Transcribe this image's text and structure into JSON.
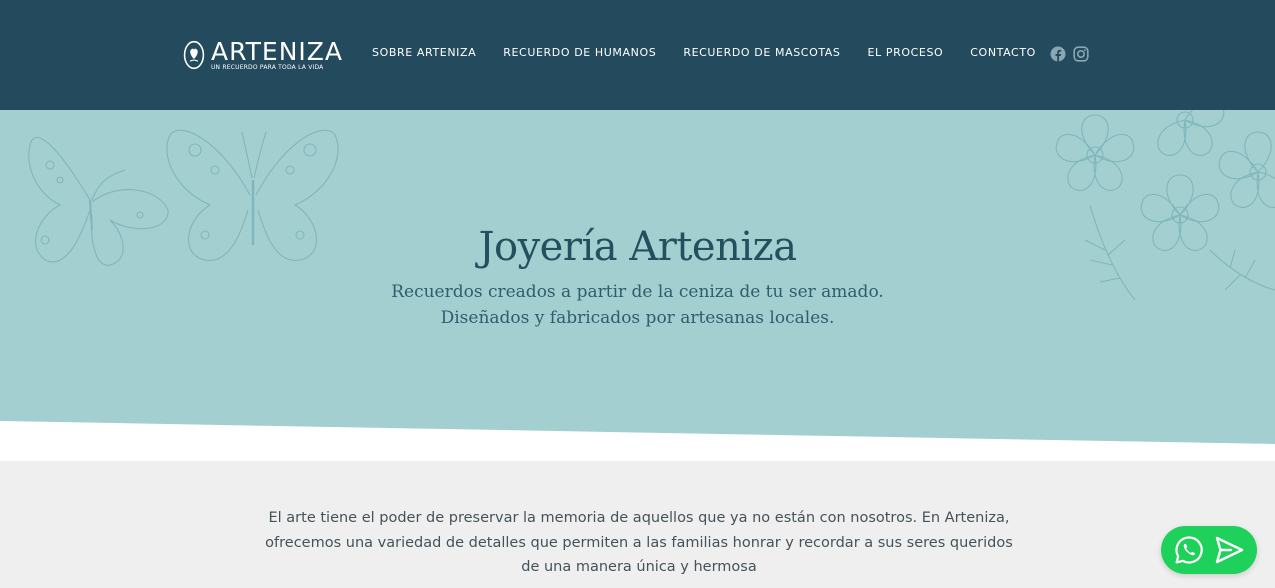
{
  "header": {
    "logo": {
      "name": "ARTENIZA",
      "tagline": "UN RECUERDO PARA TODA LA VIDA",
      "icon": "arteniza-logo-icon"
    },
    "nav": [
      {
        "label": "SOBRE ARTENIZA"
      },
      {
        "label": "RECUERDO DE HUMANOS"
      },
      {
        "label": "RECUERDO DE MASCOTAS"
      },
      {
        "label": "EL PROCESO"
      },
      {
        "label": "CONTACTO"
      }
    ],
    "social": [
      {
        "icon": "facebook-icon"
      },
      {
        "icon": "instagram-icon"
      }
    ]
  },
  "hero": {
    "title": "Joyería Arteniza",
    "subtitle_line1": "Recuerdos creados a partir de la ceniza de tu ser amado.",
    "subtitle_line2": "Diseñados y fabricados por artesanas locales."
  },
  "intro": {
    "text": "El arte tiene el poder de preservar la memoria de aquellos que ya no están con nosotros. En Arteniza, ofrecemos una variedad de detalles que permiten a las familias honrar y recordar a sus seres queridos de una manera única y hermosa"
  },
  "chat_widget": {
    "icons": [
      "whatsapp-icon",
      "send-icon"
    ]
  },
  "colors": {
    "header_bg": "#234b5d",
    "hero_bg": "#a4cfd1",
    "page_bg": "#efefef",
    "title_color": "#22505f",
    "whatsapp_green": "#1ed15a"
  }
}
